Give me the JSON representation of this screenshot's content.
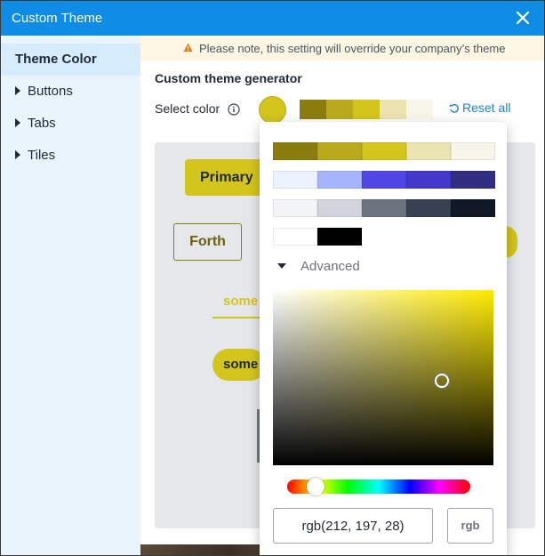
{
  "window": {
    "title": "Custom Theme"
  },
  "sidebar": {
    "items": [
      {
        "label": "Theme Color",
        "active": true
      },
      {
        "label": "Buttons"
      },
      {
        "label": "Tabs"
      },
      {
        "label": "Tiles"
      }
    ]
  },
  "notice": {
    "text": "Please note, this setting will override your company’s theme",
    "icon": "warning-icon"
  },
  "generator": {
    "title": "Custom theme generator",
    "select_label": "Select color",
    "selected_color": "#d4c51c",
    "shades": [
      "#8a7d0e",
      "#b8aa1c",
      "#d4c51c",
      "#ebe3b0",
      "#f8f6ea"
    ],
    "reset_label": "Reset all"
  },
  "preview": {
    "primary_label": "Primary",
    "forth_label": "Forth",
    "tab_label": "some",
    "pill_label": "some"
  },
  "picker": {
    "palette": [
      [
        "#8a7d0e",
        "#b8aa1c",
        "#d4c51c",
        "#ebe3b0",
        "#f8f6ea"
      ],
      [
        "#edf2ff",
        "#a6b4fb",
        "#4f46e5",
        "#4338ca",
        "#312e81"
      ],
      [
        "#f3f4f6",
        "#d1d5db",
        "#6b7280",
        "#374151",
        "#111827"
      ],
      [
        "#ffffff",
        "#000000"
      ]
    ],
    "advanced_label": "Advanced",
    "value": "rgb(212, 197, 28)",
    "mode_label": "rgb"
  }
}
